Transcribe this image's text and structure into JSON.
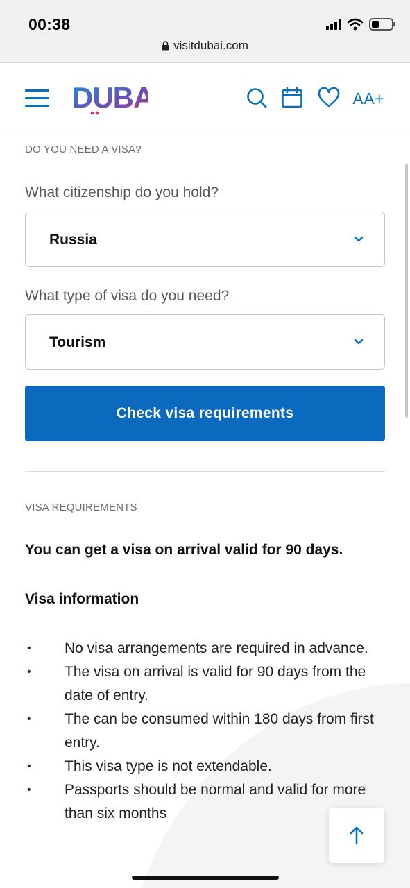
{
  "status_bar": {
    "time": "00:38"
  },
  "browser": {
    "url": "visitdubai.com"
  },
  "header": {
    "logo_text": "DUBAI",
    "icons": [
      "menu-icon",
      "search-icon",
      "calendar-icon",
      "heart-icon"
    ],
    "text_size_label": "AA+",
    "brand_color": "#0b6fbd"
  },
  "visa_form": {
    "section_title": "DO YOU NEED A VISA?",
    "citizenship_label": "What citizenship do you hold?",
    "citizenship_value": "Russia",
    "visa_type_label": "What type of visa do you need?",
    "visa_type_value": "Tourism",
    "submit_label": "Check visa requirements",
    "button_color": "#0b6abd"
  },
  "requirements": {
    "section_title": "VISA REQUIREMENTS",
    "headline": "You can get a visa on arrival valid for 90 days.",
    "info_title": "Visa information",
    "bullets": [
      "No visa arrangements are required in advance.",
      "The visa on arrival is valid for 90 days from the date of entry.",
      "The can be consumed within 180 days from first entry.",
      "This visa type is not extendable.",
      "Passports should be normal and valid for more than six months"
    ]
  }
}
